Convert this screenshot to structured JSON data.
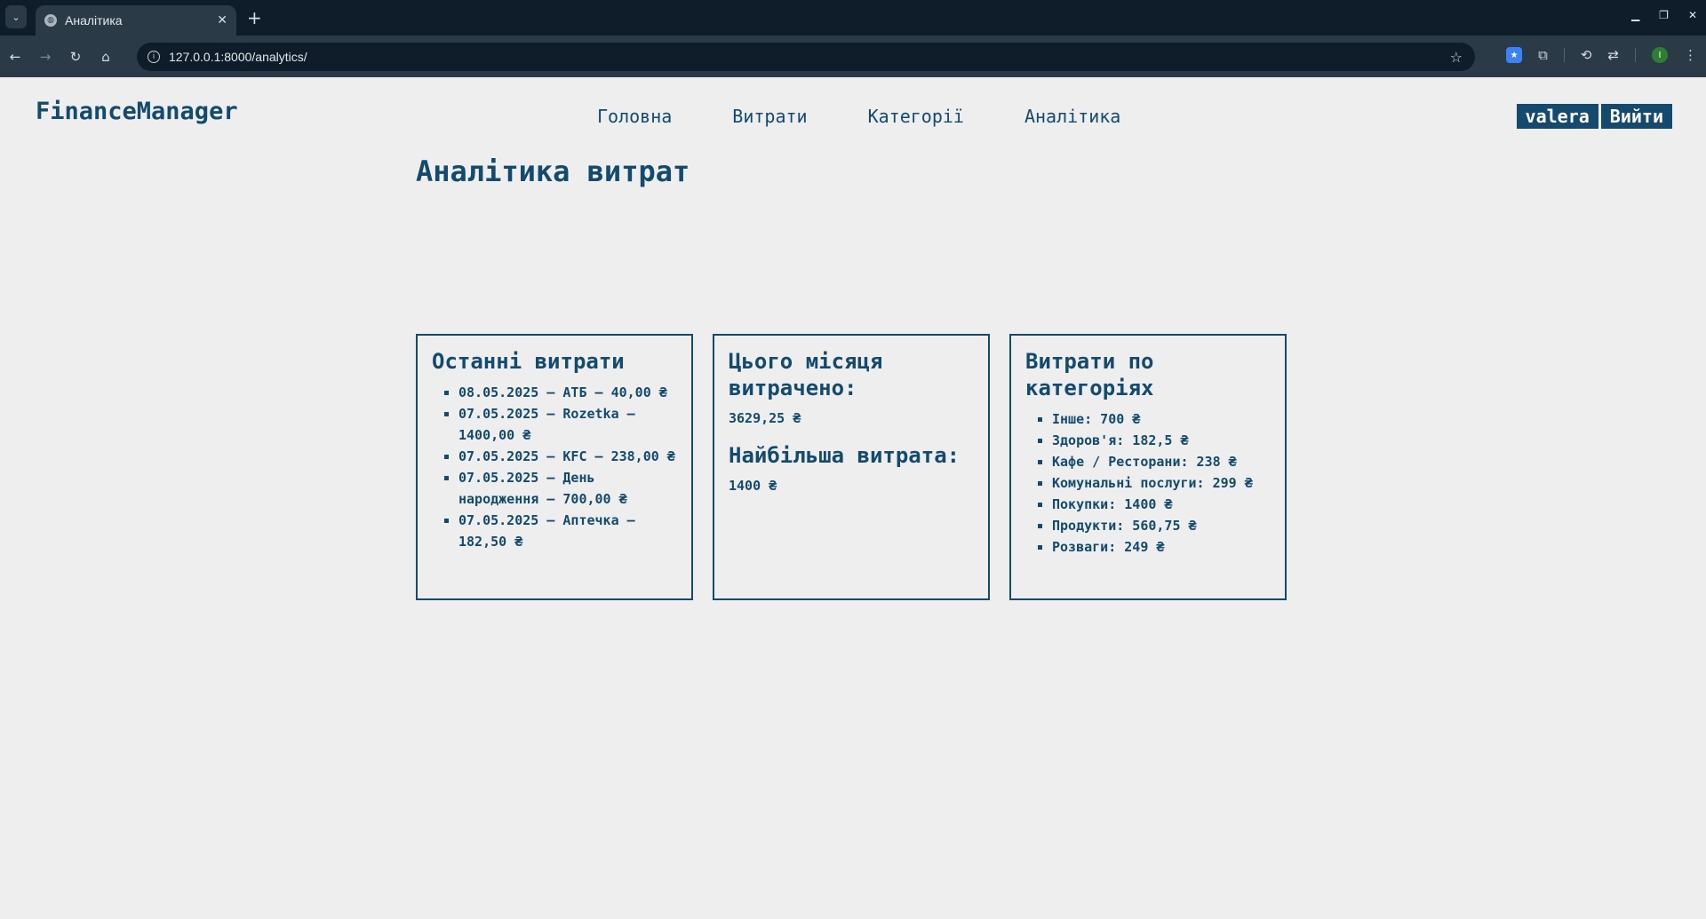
{
  "browser": {
    "tab_title": "Аналітика",
    "url": "127.0.0.1:8000/analytics/",
    "profile_initial": "I"
  },
  "header": {
    "logo": "FinanceManager",
    "nav": [
      "Головна",
      "Витрати",
      "Категорії",
      "Аналітика"
    ],
    "username": "valera",
    "logout": "Вийти"
  },
  "page": {
    "title": "Аналітика витрат"
  },
  "recent": {
    "title": "Останні витрати",
    "items": [
      "08.05.2025 — АТБ — 40,00 ₴",
      "07.05.2025 — Rozetka — 1400,00 ₴",
      "07.05.2025 — KFC — 238,00 ₴",
      "07.05.2025 — День народження — 700,00 ₴",
      "07.05.2025 — Аптечка — 182,50 ₴"
    ]
  },
  "month": {
    "title": "Цього місяця витрачено:",
    "value": "3629,25 ₴",
    "max_title": "Найбільша витрата:",
    "max_value": "1400 ₴"
  },
  "categories": {
    "title": "Витрати по категоріях",
    "items": [
      "Інше: 700 ₴",
      "Здоров'я: 182,5 ₴",
      "Кафе / Ресторани: 238 ₴",
      "Комунальні послуги: 299 ₴",
      "Покупки: 1400 ₴",
      "Продукти: 560,75 ₴",
      "Розваги: 249 ₴"
    ]
  }
}
